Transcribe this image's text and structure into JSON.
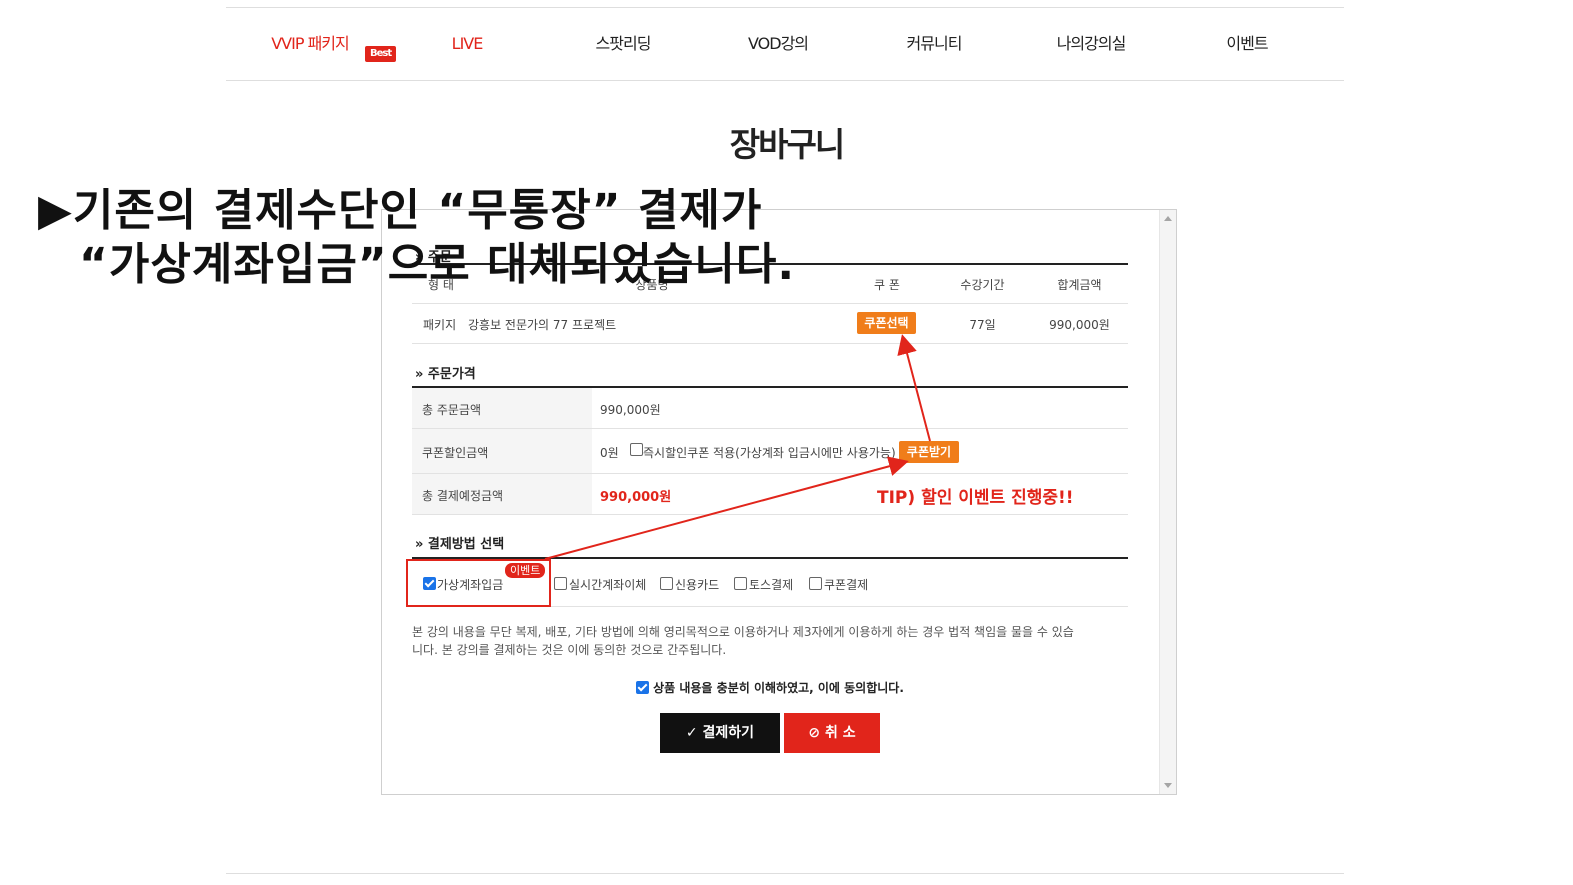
{
  "nav": {
    "items": [
      {
        "label": "VVIP 패키지",
        "badge": "Best"
      },
      {
        "label": "LIVE"
      },
      {
        "label": "스팟리딩"
      },
      {
        "label": "VOD강의"
      },
      {
        "label": "커뮤니티"
      },
      {
        "label": "나의강의실"
      },
      {
        "label": "이벤트"
      }
    ]
  },
  "page_title": "장바구니",
  "overlay_text": {
    "line1": "▶기존의 결제수단인 “무통장” 결제가",
    "line2": "“가상계좌입금”으로 대체되었습니다."
  },
  "order_info": {
    "section_title": "» 주문",
    "headers": [
      "형 태",
      "상품명",
      "쿠 폰",
      "수강기간",
      "합계금액"
    ],
    "row": {
      "type": "패키지",
      "product": "강흥보 전문가의 77 프로젝트",
      "coupon_button": "쿠폰선택",
      "period": "77일",
      "total": "990,000원"
    }
  },
  "order_price": {
    "section_title": "» 주문가격",
    "total_label": "총 주문금액",
    "total_value": "990,000원",
    "discount_label": "쿠폰할인금액",
    "discount_value": "0원",
    "instant_coupon_label": "즉시할인쿠폰 적용(가상계좌 입금시에만 사용가능)",
    "get_coupon_button": "쿠폰받기",
    "expected_label": "총 결제예정금액",
    "expected_value": "990,000원"
  },
  "payment": {
    "section_title": "» 결제방법 선택",
    "event_badge": "이벤트",
    "options": [
      {
        "label": "가상계좌입금",
        "checked": true
      },
      {
        "label": "실시간계좌이체",
        "checked": false
      },
      {
        "label": "신용카드",
        "checked": false
      },
      {
        "label": "토스결제",
        "checked": false
      },
      {
        "label": "쿠폰결제",
        "checked": false
      }
    ]
  },
  "notice": {
    "line1": "본 강의 내용을 무단 복제, 배포, 기타 방법에 의해 영리목적으로 이용하거나 제3자에게 이용하게 하는 경우 법적 책임을 물을 수 있습",
    "line2": "니다. 본 강의를 결제하는 것은 이에 동의한 것으로 간주됩니다."
  },
  "agree_label": "상품 내용을 충분히 이해하였고, 이에 동의합니다.",
  "buttons": {
    "pay": "결제하기",
    "cancel": "취 소"
  },
  "tip_text": "TIP) 할인 이벤트 진행중!!",
  "colors": {
    "accent_red": "#e1251b",
    "coupon_orange": "#f07d1a",
    "pay_button": "#111111"
  }
}
